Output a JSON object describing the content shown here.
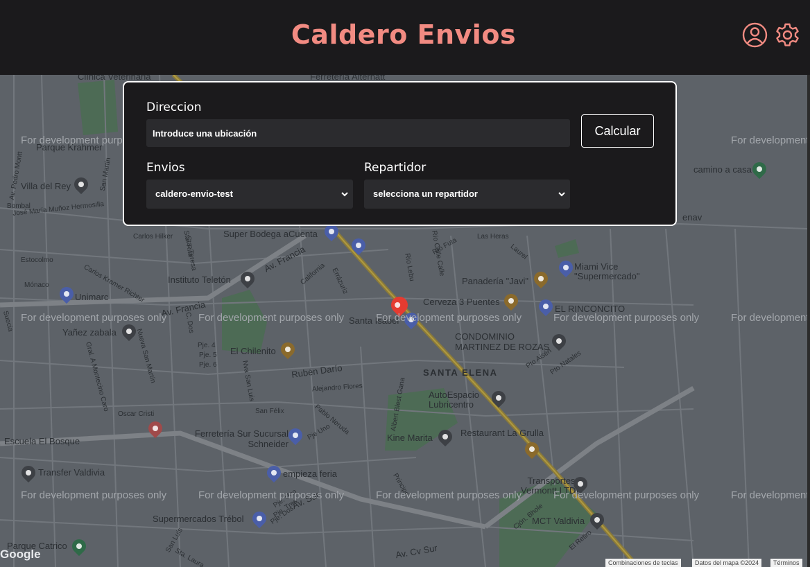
{
  "app": {
    "title": "Caldero Envios"
  },
  "form": {
    "address_label": "Direccion",
    "address_placeholder": "Introduce una ubicación",
    "submit_label": "Calcular",
    "envios_label": "Envios",
    "envios_selected": "caldero-envio-test",
    "repartidor_label": "Repartidor",
    "repartidor_selected": "selecciona un repartidor"
  },
  "map": {
    "watermark": "For development purposes only",
    "labels": [
      "Clínica Veterinaria",
      "Ferretería Alternatt",
      "Parque Krahmer",
      "Villa del Rey",
      "Av. Pedro Montt",
      "Bombal",
      "José María Muñoz Hermosilla",
      "Carlos Hilker",
      "Sta. Rita",
      "Sta. Teresa",
      "Super Bodega aCuenta",
      "Av. Francia",
      "Estocolmo",
      "Mónaco",
      "Instituto Teletón",
      "Carlos Kramer Richter",
      "California",
      "Errázuriz",
      "Unimarc",
      "Av. Francia",
      "Panadería \"Javi\"",
      "Miami Vice \"Supermercado\"",
      "Cerveza 3 Puentes",
      "EL RINCONCITO",
      "Santa Isabel",
      "Yañez zabala",
      "CONDOMINIO MARTINEZ DE ROZAS",
      "El Chilenito",
      "Pje. 4",
      "Pje. 5",
      "Pje. 6",
      "Rubén Darío",
      "Alejandro Flores",
      "SANTA ELENA",
      "AutoEspacio Lubricentro",
      "Oscar Cristi",
      "San Félix",
      "Pablo Neruda",
      "Escuela El Bosque",
      "Ferretería Sur Sucursal Schneider",
      "Pje Uno",
      "Kine Marita",
      "Restaurant La Grulla",
      "Transfer Valdivia",
      "empieza feria",
      "Transportes Vermontt LTDA",
      "Av. Sur",
      "Supermercados Trébol",
      "MCT Valdivia",
      "Parque Catrico",
      "Av. Cv Sur",
      "camino a casa",
      "Río Futa",
      "Las Heras",
      "Laurel",
      "Río Calle Calle",
      "Río Lebu",
      "Pto Aisén",
      "Pto Natales",
      "Gral. A Montecino Caro",
      "Nueva San Martín",
      "Suecia",
      "C. Dos",
      "Nva San Luis",
      "San Martín",
      "enav",
      "Pje. Dos",
      "Pje. Tres",
      "Pje. Uno",
      "Principe",
      "Albert Blest Gana",
      "Cjón. Bhole",
      "El Retiro",
      "Sta. Laura",
      "San Luis"
    ],
    "google_logo": "Google",
    "attribution": [
      "Combinaciones de teclas",
      "Datos del mapa ©2024",
      "Términos"
    ]
  },
  "colors": {
    "accent": "#f28b82",
    "header_bg": "#1b1a1c",
    "panel_bg": "#1b1a1c",
    "field_bg": "#2b2b2e",
    "map_bg": "#5d6268",
    "main_road": "#8a7a3a"
  },
  "icons": [
    "user-icon",
    "gear-icon",
    "chevron-down-icon",
    "map-pin-icon"
  ]
}
